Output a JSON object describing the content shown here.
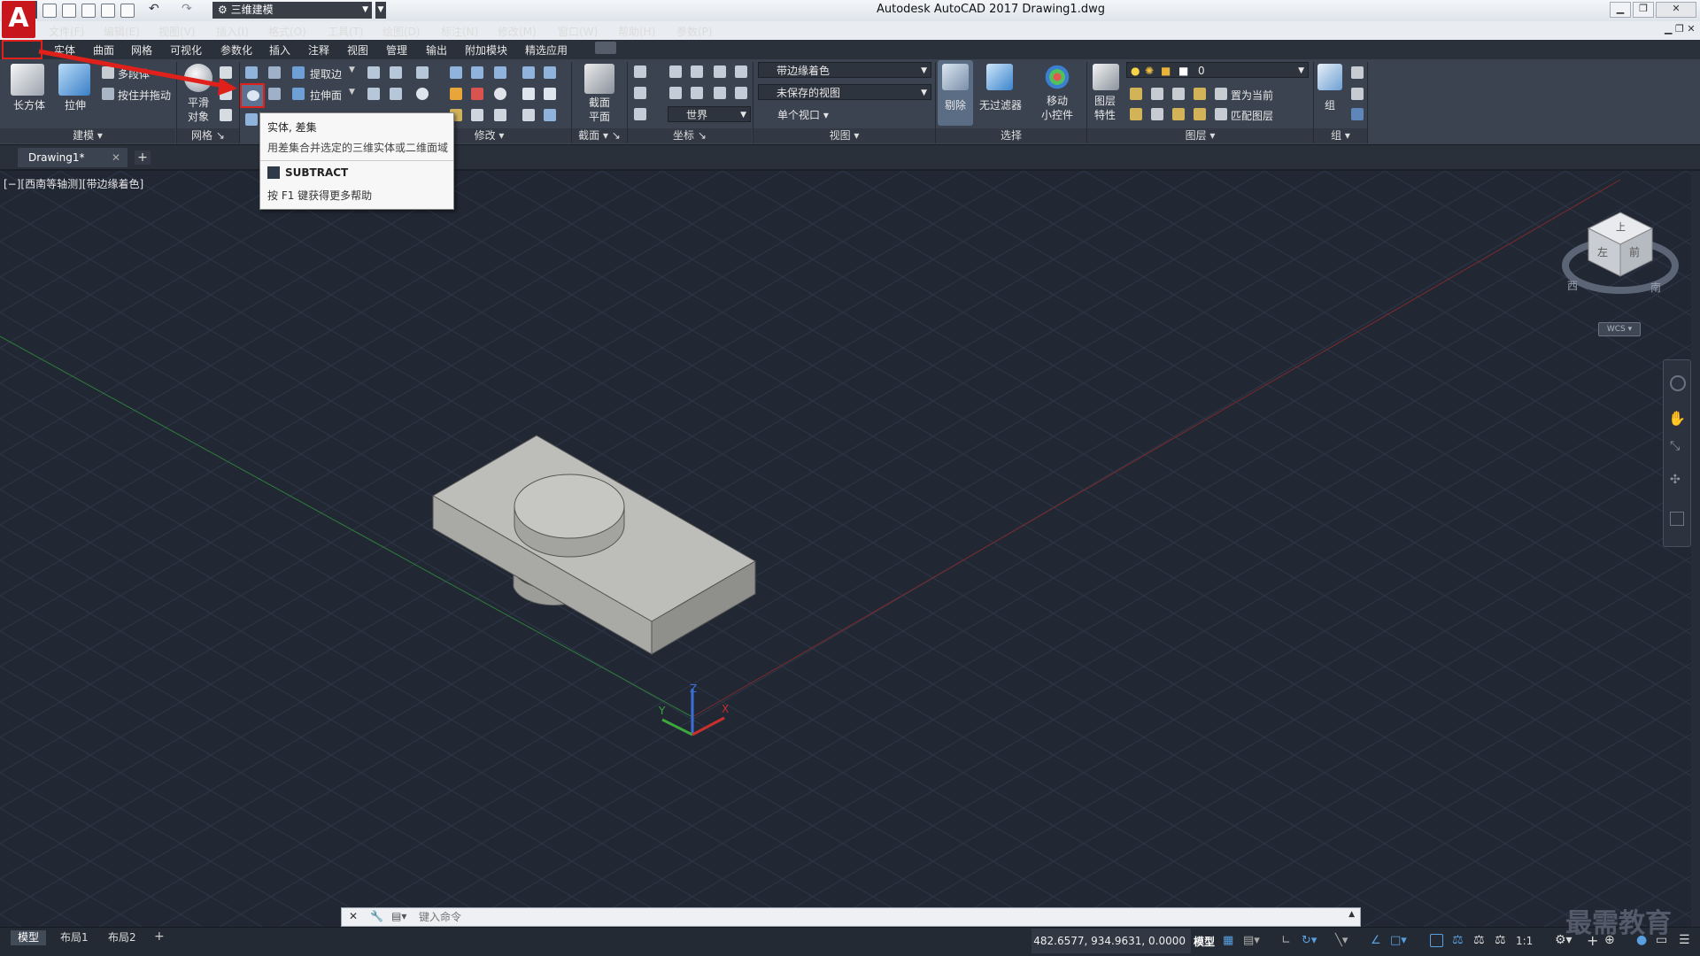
{
  "app": {
    "logo": "A",
    "title": "Autodesk AutoCAD 2017    Drawing1.dwg",
    "workspace": "三维建模"
  },
  "menus": [
    "文件(F)",
    "编辑(E)",
    "视图(V)",
    "插入(I)",
    "格式(O)",
    "工具(T)",
    "绘图(D)",
    "标注(N)",
    "修改(M)",
    "窗口(W)",
    "帮助(H)",
    "参数(P)"
  ],
  "ribbon_tabs": [
    "常用",
    "实体",
    "曲面",
    "网格",
    "可视化",
    "参数化",
    "插入",
    "注释",
    "视图",
    "管理",
    "输出",
    "附加模块",
    "精选应用"
  ],
  "ribbon": {
    "box": "长方体",
    "extrude": "拉伸",
    "polysolid": "多段体",
    "presspull": "按住并拖动",
    "smooth": "平滑\n对象",
    "extract_edges": "提取边",
    "extrude_faces": "拉伸面",
    "section_plane": "截面\n平面",
    "visual_style": "带边缘着色",
    "unsaved_view": "未保存的视图",
    "single_viewport": "单个视口",
    "ucs_world": "世界",
    "culling": "剔除",
    "no_filter": "无过滤器",
    "gizmo": "移动\n小控件",
    "layer_props": "图层\n特性",
    "layer_name": "0",
    "make_current": "置为当前",
    "match_layer": "匹配图层",
    "group": "组",
    "panels": {
      "modeling": "建模",
      "mesh": "网格",
      "modify": "修改",
      "section": "截面",
      "coordinates": "坐标",
      "view": "视图",
      "selection": "选择",
      "layers": "图层",
      "groups": "组"
    }
  },
  "tooltip": {
    "title": "实体, 差集",
    "desc": "用差集合并选定的三维实体或二维面域",
    "command": "SUBTRACT",
    "help": "按 F1 键获得更多帮助"
  },
  "doc_tab": "Drawing1*",
  "viewport_label": "[−][西南等轴测][带边缘着色]",
  "viewcube": {
    "top": "上",
    "left": "左",
    "front": "前",
    "compass_w": "西",
    "compass_s": "南",
    "wcs": "WCS"
  },
  "ucs_axes": {
    "x": "X",
    "y": "Y",
    "z": "Z"
  },
  "command_placeholder": "键入命令",
  "layout_tabs": [
    "模型",
    "布局1",
    "布局2"
  ],
  "status": {
    "coords": "482.6577, 934.9631, 0.0000",
    "model": "模型",
    "scale": "1:1"
  },
  "watermark": "最需教育",
  "colors": {
    "viewport_bg": "#212834",
    "ribbon_bg": "#3b4350",
    "highlight_red": "#e0201a",
    "logo_red": "#c7161c"
  }
}
